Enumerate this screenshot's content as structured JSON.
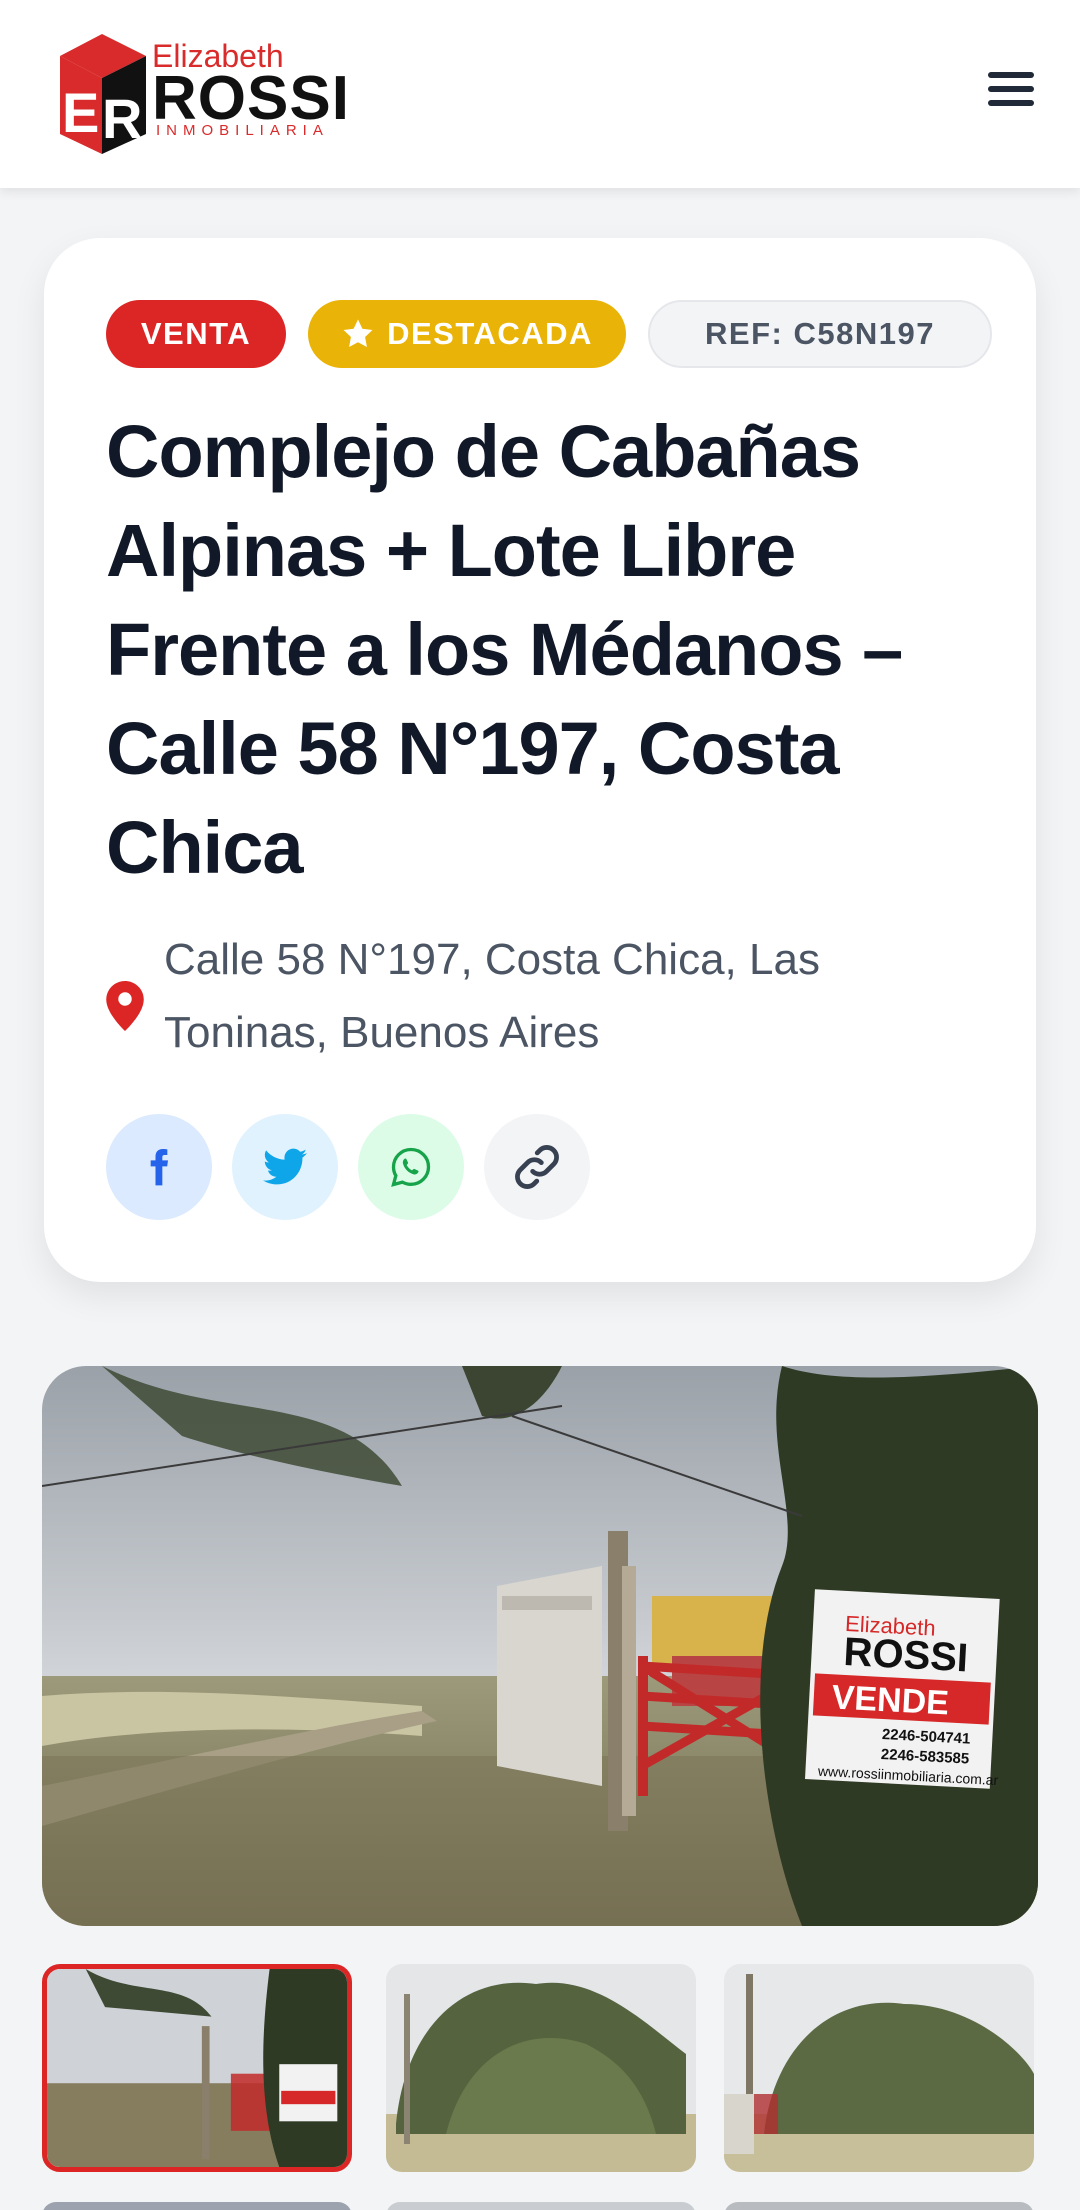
{
  "header": {
    "logo": {
      "top_text": "Elizabeth",
      "main_text": "ROSSI",
      "sub_text": "INMOBILIARIA",
      "mark_text": "ER"
    },
    "menu_icon": "hamburger-menu-icon"
  },
  "listing": {
    "badges": {
      "operation": "VENTA",
      "featured": "DESTACADA",
      "reference": "REF: C58N197"
    },
    "title": "Complejo de Cabañas Alpinas + Lote Libre Frente a los Médanos – Calle 58 N°197, Costa Chica",
    "address": "Calle 58 N°197, Costa Chica, Las Toninas, Buenos Aires",
    "share": [
      "facebook-icon",
      "twitter-icon",
      "whatsapp-icon",
      "link-icon"
    ]
  },
  "gallery": {
    "main_image": "property-photo-street-with-sale-sign",
    "sign": {
      "brand_top": "Elizabeth",
      "brand_main": "ROSSI",
      "label": "VENDE",
      "phone_1": "2246-504741",
      "phone_2": "2246-583585",
      "web": "www.rossiinmobiliaria.com.ar"
    },
    "thumbnails": [
      "thumb-street-sign",
      "thumb-trees-lot",
      "thumb-trees-pole"
    ],
    "selected_index": 0
  },
  "colors": {
    "accent_red": "#dc2626",
    "featured_yellow": "#eab308",
    "title_dark": "#111827",
    "muted_text": "#4b5563",
    "background": "#f3f4f6"
  }
}
